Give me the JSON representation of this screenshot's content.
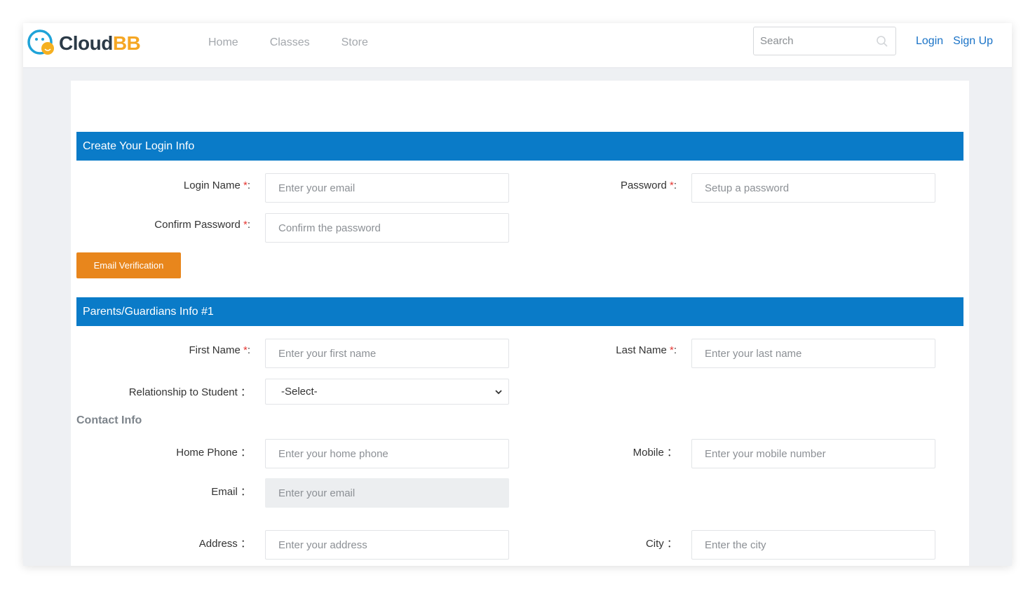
{
  "header": {
    "logo_text_a": "Cloud",
    "logo_text_b": "BB",
    "nav": [
      "Home",
      "Classes",
      "Store"
    ],
    "search_placeholder": "Search",
    "login": "Login",
    "signup": "Sign Up"
  },
  "login_section": {
    "title": "Create Your Login Info",
    "login_name_label": "Login Name",
    "login_name_placeholder": "Enter your email",
    "password_label": "Password",
    "password_placeholder": "Setup a password",
    "confirm_label": "Confirm Password",
    "confirm_placeholder": "Confirm the password",
    "verify_button": "Email Verification"
  },
  "parents_section": {
    "title": "Parents/Guardians Info #1",
    "first_name_label": "First Name",
    "first_name_placeholder": "Enter your first name",
    "last_name_label": "Last Name",
    "last_name_placeholder": "Enter your last name",
    "relationship_label": "Relationship to Student",
    "relationship_value": "-Select-",
    "contact_heading": "Contact Info",
    "home_phone_label": "Home Phone",
    "home_phone_placeholder": "Enter your home phone",
    "mobile_label": "Mobile",
    "mobile_placeholder": "Enter your mobile number",
    "email_label": "Email",
    "email_placeholder": "Enter your email",
    "address_label": "Address",
    "address_placeholder": "Enter your address",
    "city_label": "City",
    "city_placeholder": "Enter the city"
  },
  "required_mark": "*",
  "colon": ":",
  "colon_wide": "："
}
